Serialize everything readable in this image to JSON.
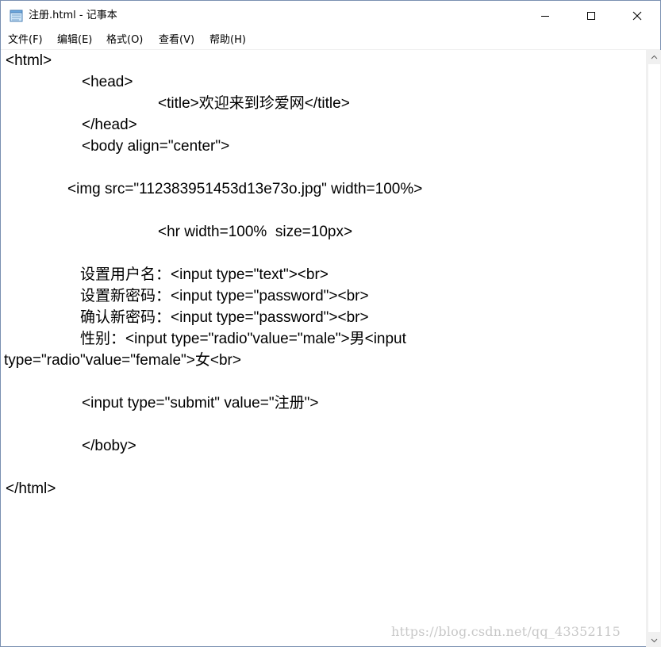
{
  "window": {
    "title": "注册.html - 记事本",
    "controls": {
      "minimize": "minimize-icon",
      "maximize": "maximize-icon",
      "close": "close-icon"
    }
  },
  "menu": {
    "items": [
      {
        "label": "文件(F)"
      },
      {
        "label": "编辑(E)"
      },
      {
        "label": "格式(O)"
      },
      {
        "label": "查看(V)"
      },
      {
        "label": "帮助(H)"
      }
    ]
  },
  "editor": {
    "lines": [
      "<html>",
      "<head>",
      "<title>欢迎来到珍爱网</title>",
      "</head>",
      "<body align=\"center\">",
      "<img src=\"112383951453d13e73o.jpg\" width=100%>",
      "<hr width=100%  size=10px>",
      "设置用户名：<input type=\"text\"><br>",
      "设置新密码：<input type=\"password\"><br>",
      "确认新密码：<input type=\"password\"><br>",
      "性别：<input type=\"radio\"value=\"male\">男<input",
      "type=\"radio\"value=\"female\">女<br>",
      "<input type=\"submit\" value=\"注册\">",
      "</boby>",
      "</html>"
    ]
  },
  "watermark": "https://blog.csdn.net/qq_43352115"
}
